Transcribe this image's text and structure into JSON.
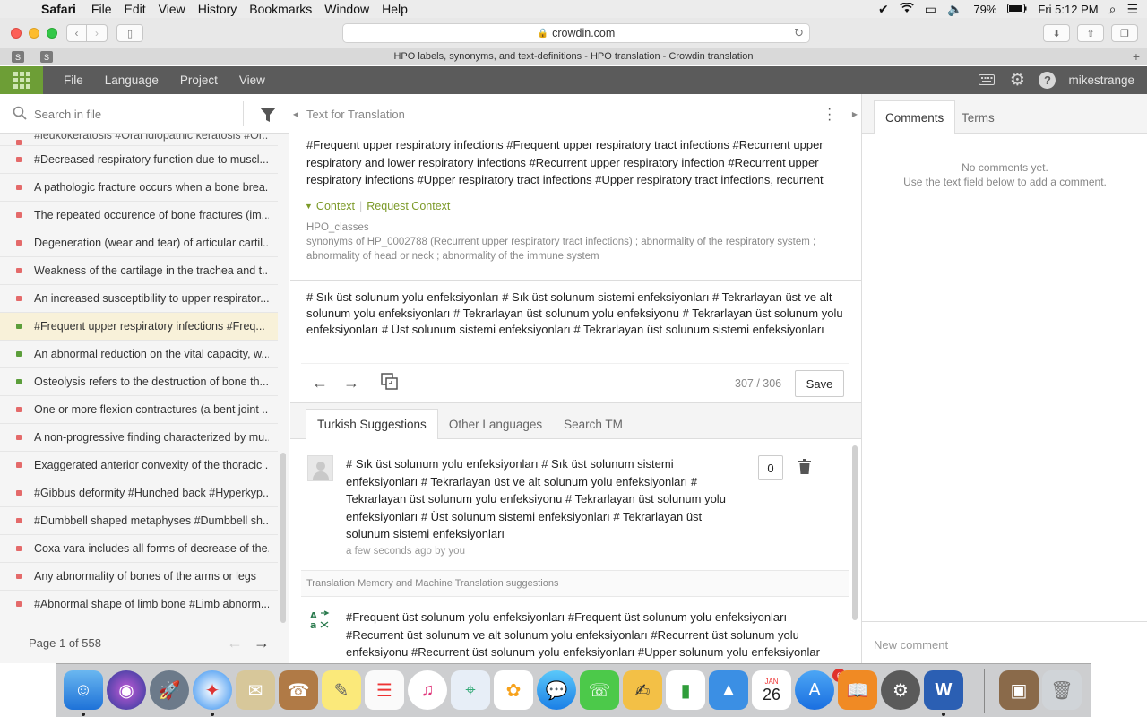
{
  "menubar": {
    "app": "Safari",
    "items": [
      "File",
      "Edit",
      "View",
      "History",
      "Bookmarks",
      "Window",
      "Help"
    ],
    "battery": "79%",
    "clock": "Fri 5:12 PM"
  },
  "browser": {
    "url": "crowdin.com",
    "pinned_tabs": [
      "S",
      "S"
    ],
    "tab_title": "HPO labels, synonyms, and text-definitions - HPO translation - Crowdin translation"
  },
  "header": {
    "menu": [
      "File",
      "Language",
      "Project",
      "View"
    ],
    "username": "mikestrange"
  },
  "left": {
    "search_placeholder": "Search in file",
    "first_row": "#leukokeratosis #Oral idiopathic keratosis #Or...",
    "rows": [
      {
        "text": "#Decreased respiratory function due to muscl...",
        "status": "red"
      },
      {
        "text": "A pathologic fracture occurs when a bone brea...",
        "status": "red"
      },
      {
        "text": "The repeated occurence of bone fractures (im...",
        "status": "red"
      },
      {
        "text": "Degeneration (wear and tear) of articular cartil...",
        "status": "red"
      },
      {
        "text": "Weakness of the cartilage in the trachea and t...",
        "status": "red"
      },
      {
        "text": "An increased susceptibility to upper respirator...",
        "status": "red"
      },
      {
        "text": "#Frequent upper respiratory infections #Freq...",
        "status": "green",
        "active": true
      },
      {
        "text": "An abnormal reduction on the vital capacity, w...",
        "status": "green"
      },
      {
        "text": "Osteolysis refers to the destruction of bone th...",
        "status": "green"
      },
      {
        "text": "One or more flexion contractures (a bent joint ...",
        "status": "red"
      },
      {
        "text": "A non-progressive finding characterized by mu...",
        "status": "red"
      },
      {
        "text": "Exaggerated anterior convexity of the thoracic ...",
        "status": "red"
      },
      {
        "text": "#Gibbus deformity #Hunched back #Hyperkyp...",
        "status": "red"
      },
      {
        "text": "#Dumbbell shaped metaphyses #Dumbbell sh...",
        "status": "red"
      },
      {
        "text": "Coxa vara includes all forms of decrease of the...",
        "status": "red"
      },
      {
        "text": "Any abnormality of bones of the arms or legs",
        "status": "red"
      },
      {
        "text": "#Abnormal shape of limb bone #Limb abnorm...",
        "status": "red"
      }
    ],
    "page_label": "Page 1 of 558"
  },
  "center": {
    "title": "Text for Translation",
    "source_text": "#Frequent upper respiratory infections #Frequent upper respiratory tract infections #Recurrent upper respiratory and lower respiratory infections #Recurrent upper respiratory infection #Recurrent upper respiratory infections #Upper respiratory tract infections #Upper respiratory tract infections, recurrent",
    "context_label": "Context",
    "request_context_label": "Request Context",
    "file_name": "HPO_classes",
    "context_text": "synonyms of HP_0002788 (Recurrent upper respiratory tract infections) ; abnormality of the respiratory system ; abnormality of head or neck ; abnormality of the immune system",
    "translation_text": "# Sık üst solunum yolu enfeksiyonları # Sık üst solunum sistemi enfeksiyonları # Tekrarlayan üst ve alt solunum yolu enfeksiyonları # Tekrarlayan üst solunum yolu enfeksiyonu # Tekrarlayan üst solunum yolu enfeksiyonları # Üst solunum sistemi enfeksiyonları # Tekrarlayan üst solunum sistemi enfeksiyonları",
    "char_count": "307 / 306",
    "save_label": "Save",
    "tabs": [
      "Turkish Suggestions",
      "Other Languages",
      "Search TM"
    ],
    "suggestion_text": "# Sık üst solunum yolu enfeksiyonları # Sık üst solunum sistemi enfeksiyonları # Tekrarlayan üst ve alt solunum yolu enfeksiyonları # Tekrarlayan üst solunum yolu enfeksiyonu # Tekrarlayan üst solunum yolu enfeksiyonları # Üst solunum sistemi enfeksiyonları # Tekrarlayan üst solunum sistemi enfeksiyonları",
    "suggestion_meta": "a few seconds ago by you",
    "vote_count": "0",
    "tm_header": "Translation Memory and Machine Translation suggestions",
    "mt_text": "#Frequent üst solunum yolu enfeksiyonları #Frequent üst solunum yolu enfeksiyonları #Recurrent üst solunum ve alt solunum yolu enfeksiyonları #Recurrent üst solunum yolu enfeksiyonu #Recurrent üst solunum yolu enfeksiyonları #Upper solunum yolu enfeksiyonlar"
  },
  "right": {
    "tabs": [
      "Comments",
      "Terms"
    ],
    "no_comments": "No comments yet.",
    "no_comments_hint": "Use the text field below to add a comment.",
    "new_comment_placeholder": "New comment"
  },
  "dock": {
    "calendar_month": "JAN",
    "calendar_day": "26",
    "appstore_badge": "6"
  },
  "colors": {
    "accent_green": "#6d9e36",
    "header_bg": "#5b5b5b",
    "status_red": "#e46a6a",
    "status_green": "#5c9e3b",
    "context_green": "#7c9a28"
  }
}
